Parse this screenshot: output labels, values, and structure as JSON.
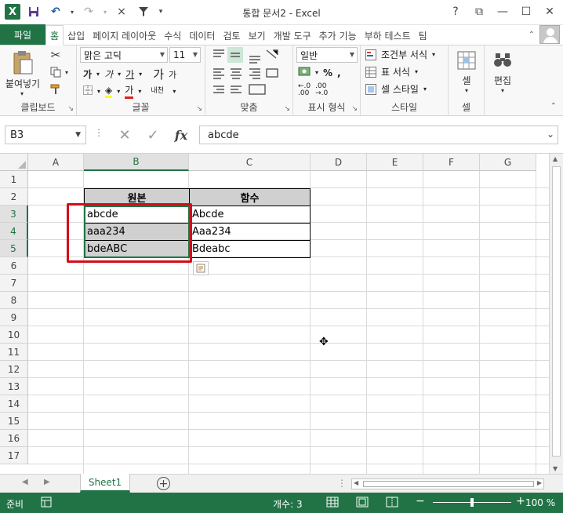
{
  "window": {
    "title": "통합 문서2 - Excel",
    "app_icon": "X",
    "controls": [
      "?",
      "⧉",
      "—",
      "☐",
      "✕"
    ]
  },
  "qat": {
    "save": "💾",
    "undo": "↶",
    "redo": "↷",
    "close": "×",
    "filter": "⏷"
  },
  "ribbon_tabs": [
    "파일",
    "홈",
    "삽입",
    "페이지 레이아웃",
    "수식",
    "데이터",
    "검토",
    "보기",
    "개발 도구",
    "추가 기능",
    "부하 테스트",
    "팀"
  ],
  "active_tab": "홈",
  "ribbon": {
    "clipboard": {
      "label": "클립보드",
      "paste": "붙여넣기"
    },
    "font": {
      "label": "글꼴",
      "font_name": "맑은 고딕",
      "font_size": "11",
      "bold": "가",
      "italic": "가",
      "underline": "가",
      "grow": "가",
      "shrink": "가",
      "color_char": "가",
      "phonetic": "내천"
    },
    "alignment": {
      "label": "맞춤"
    },
    "number": {
      "label": "표시 형식",
      "format": "일반",
      "percent": "%",
      "comma": ","
    },
    "styles": {
      "label": "스타일",
      "conditional": "조건부 서식",
      "table": "표 서식",
      "cell_style": "셀 스타일"
    },
    "cells": {
      "label": "셀"
    },
    "editing": {
      "label": "편집"
    }
  },
  "formula_bar": {
    "name_box": "B3",
    "content": "abcde",
    "fx": "fx"
  },
  "columns": [
    "A",
    "B",
    "C",
    "D",
    "E",
    "F",
    "G"
  ],
  "rows": [
    "1",
    "2",
    "3",
    "4",
    "5",
    "6",
    "7",
    "8",
    "9",
    "10",
    "11",
    "12",
    "13",
    "14",
    "15",
    "16",
    "17"
  ],
  "table": {
    "header_original": "원본",
    "header_function": "함수",
    "original": [
      "abcde",
      "aaa234",
      "bdeABC"
    ],
    "function": [
      "Abcde",
      "Aaa234",
      "Bdeabc"
    ]
  },
  "sheet_tabs": [
    "Sheet1"
  ],
  "status": {
    "ready": "준비",
    "count": "개수: 3",
    "zoom": "100 %"
  },
  "colors": {
    "accent": "#217346",
    "highlight_box": "#d10e1a",
    "header_fill": "#d0d0d0"
  }
}
